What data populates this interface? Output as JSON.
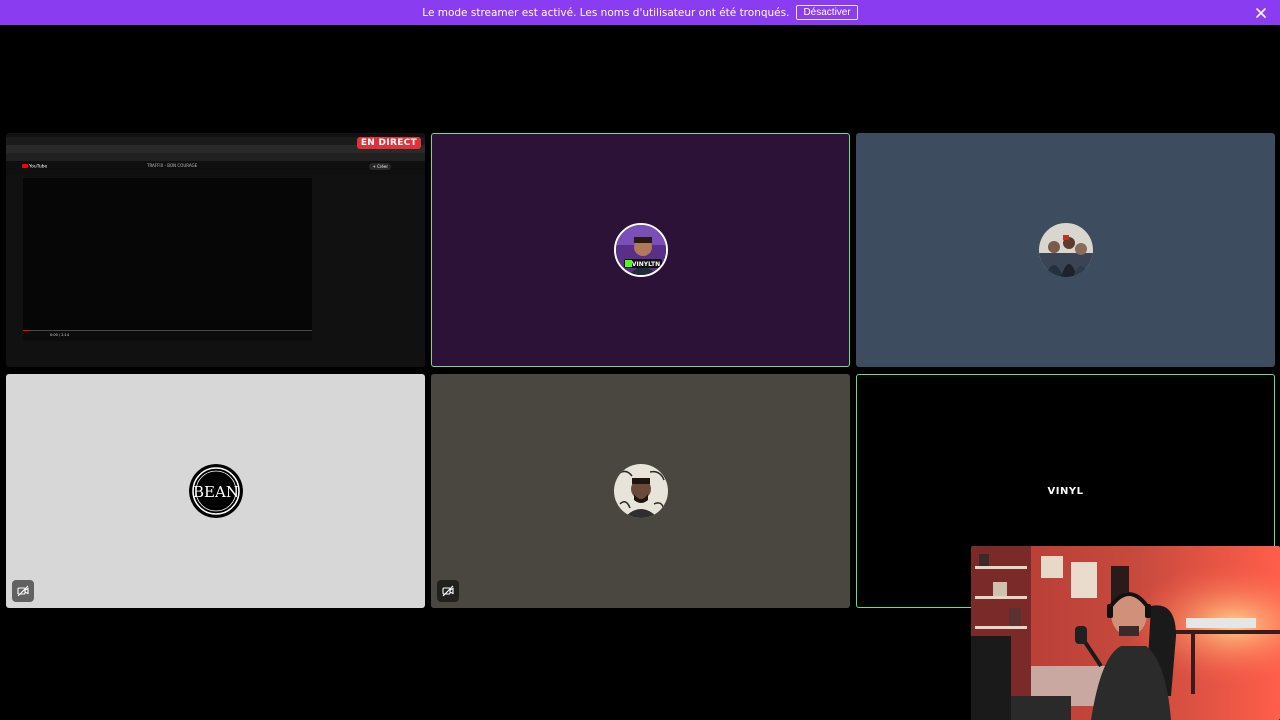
{
  "banner": {
    "message": "Le mode streamer est activé. Les noms d'utilisateur ont été tronqués.",
    "button_label": "Désactiver",
    "close_icon": "close-icon",
    "background": "#8a3df0"
  },
  "tiles": [
    {
      "id": "screen-share",
      "badge": "EN DIRECT",
      "share": {
        "yt_logo": "YouTube",
        "search_text": "TRAFFIX - BON COURAGE",
        "create_label": "+ Créer",
        "time": "0:00 / 2:14"
      }
    },
    {
      "id": "participant-2",
      "avatar_label": "VINYLTN",
      "background": "#2c1237",
      "speaking": true
    },
    {
      "id": "participant-3",
      "background": "#3d4c5e",
      "speaking": false
    },
    {
      "id": "participant-4",
      "avatar_label": "BEAN",
      "background": "#d7d7d7",
      "muted": true
    },
    {
      "id": "participant-5",
      "background": "#4a4740",
      "muted": true
    },
    {
      "id": "participant-6",
      "avatar_label": "VINYL",
      "background": "#000000",
      "speaking": true
    }
  ],
  "colors": {
    "speaking_border": "#6ddc8e",
    "live_badge": "#e0323a"
  }
}
